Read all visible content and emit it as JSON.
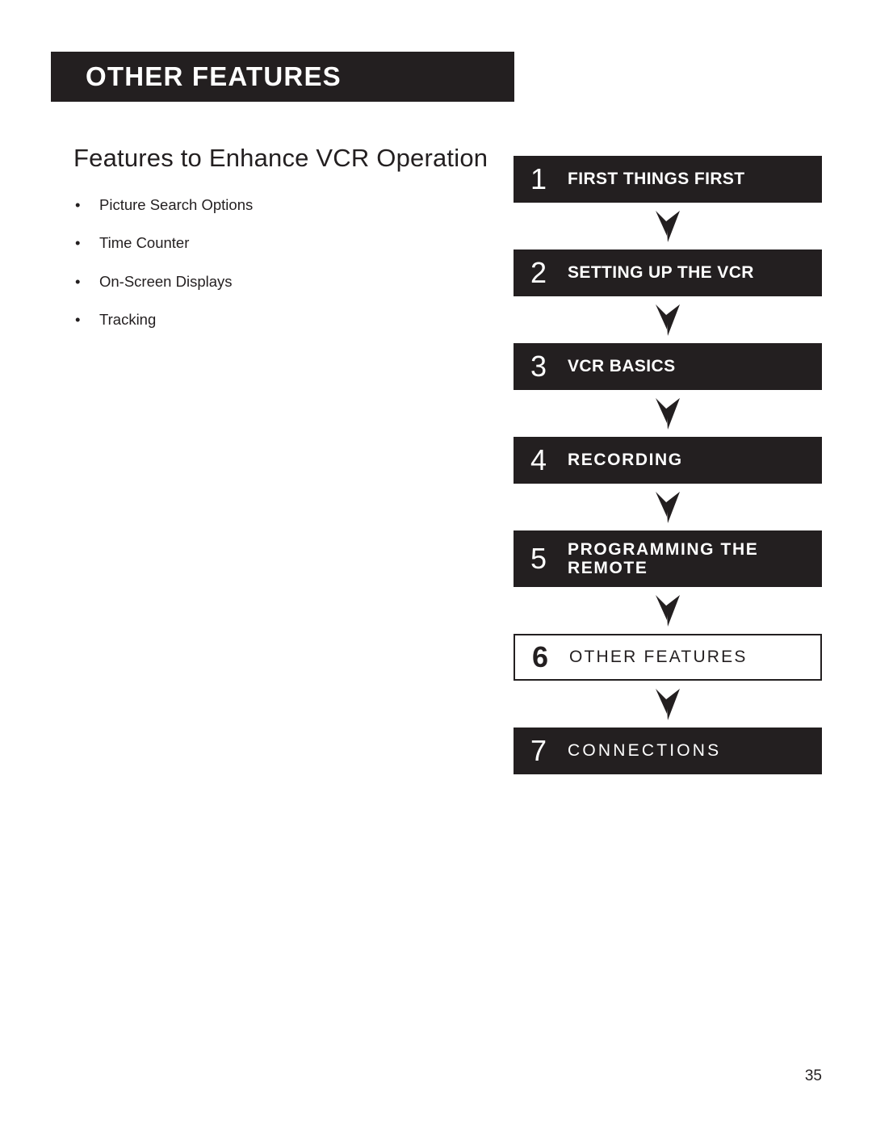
{
  "header": {
    "title": "OTHER FEATURES"
  },
  "main": {
    "section_heading": "Features to Enhance VCR Operation",
    "bullet_marker": "•",
    "bullets": [
      "Picture Search Options",
      "Time Counter",
      "On-Screen Displays",
      "Tracking"
    ]
  },
  "chapter_flow": {
    "arrow_icon": "down-arrow-icon",
    "chapters": [
      {
        "number": "1",
        "label": "FIRST THINGS FIRST",
        "current": false
      },
      {
        "number": "2",
        "label": "SETTING UP THE VCR",
        "current": false
      },
      {
        "number": "3",
        "label": "VCR BASICS",
        "current": false
      },
      {
        "number": "4",
        "label": "RECORDING",
        "current": false
      },
      {
        "number": "5",
        "label": "PROGRAMMING THE\nREMOTE",
        "current": false
      },
      {
        "number": "6",
        "label": "OTHER FEATURES",
        "current": true
      },
      {
        "number": "7",
        "label": "CONNECTIONS",
        "current": false
      }
    ]
  },
  "footer": {
    "page_number": "35"
  },
  "colors": {
    "ink": "#231f20",
    "paper": "#ffffff"
  }
}
